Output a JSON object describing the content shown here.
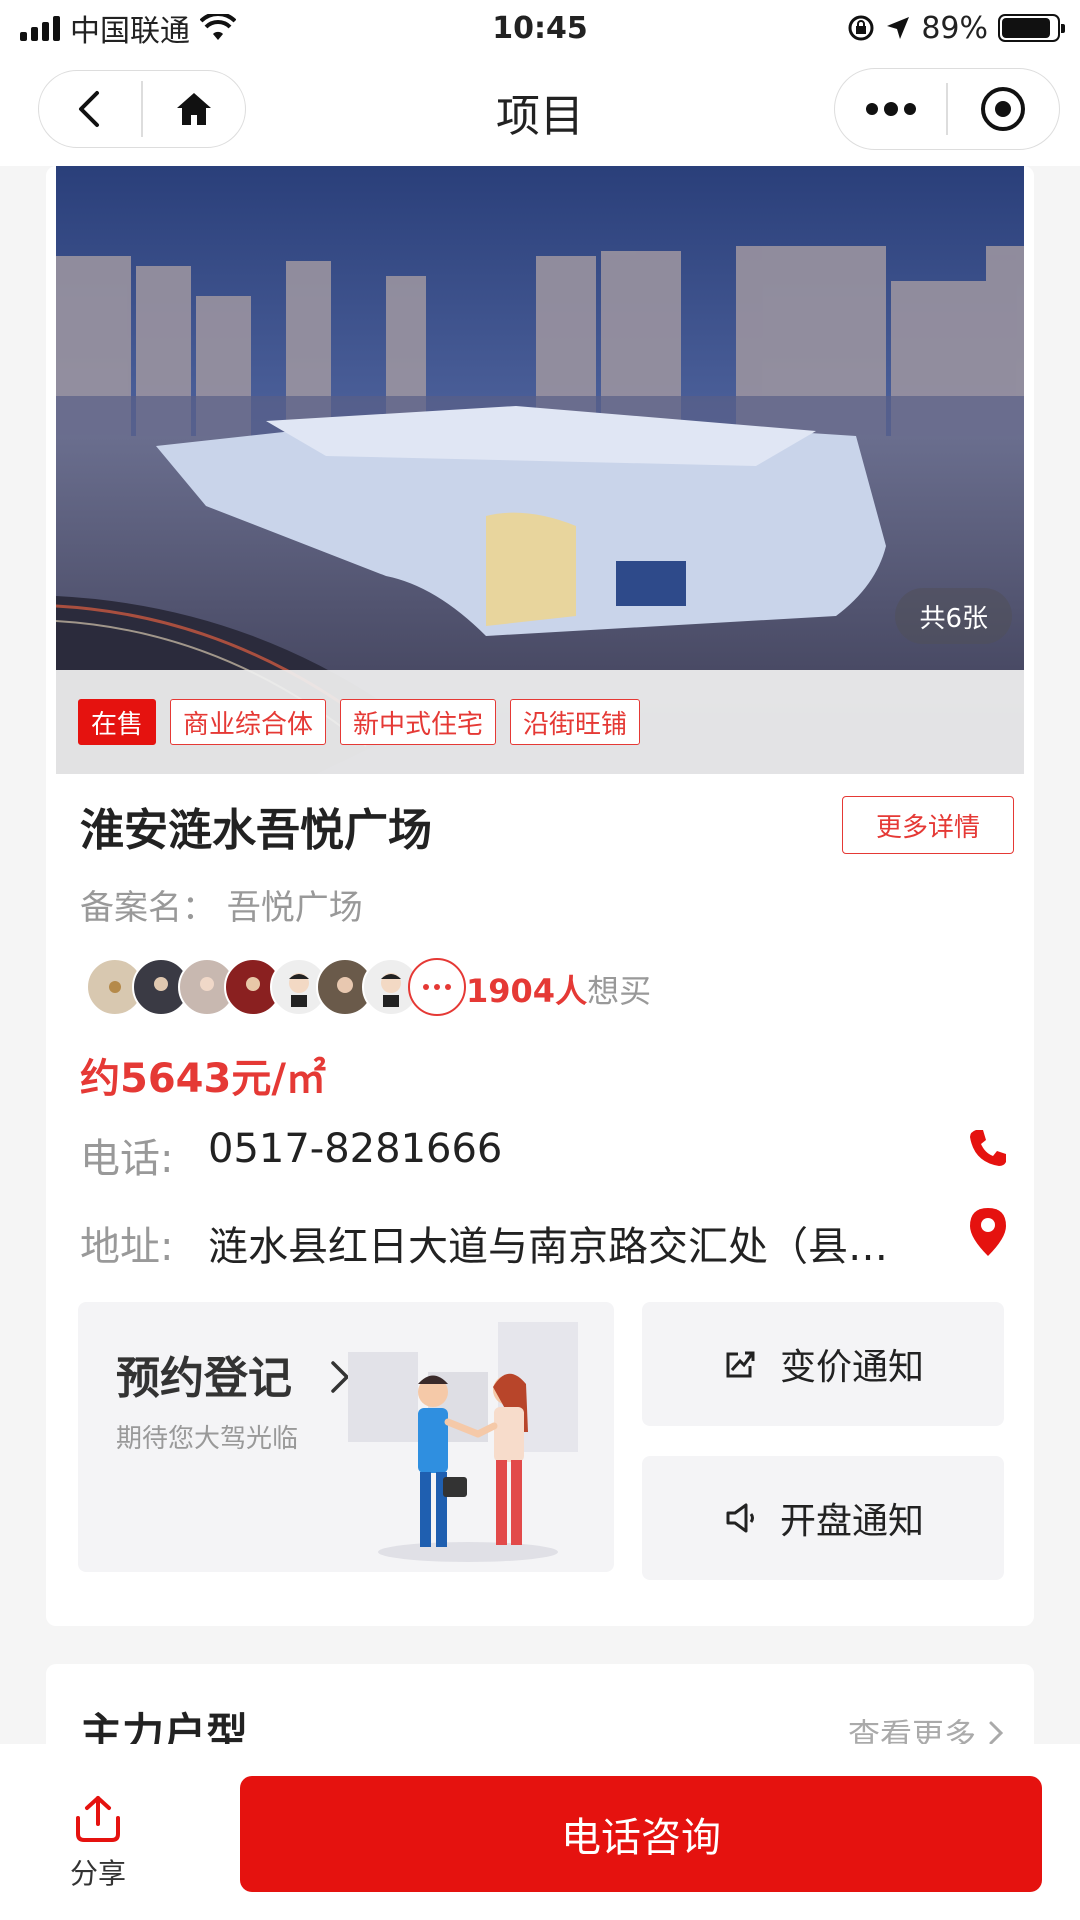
{
  "status_bar": {
    "carrier": "中国联通",
    "time": "10:45",
    "battery": "89%",
    "battery_level": 0.89
  },
  "nav": {
    "title": "项目"
  },
  "project": {
    "photo_count": "共6张",
    "tags": [
      "在售",
      "商业综合体",
      "新中式住宅",
      "沿街旺铺"
    ],
    "name": "淮安涟水吾悦广场",
    "more_details": "更多详情",
    "record_name": "备案名：  吾悦广场",
    "want_count": "1904人",
    "want_label": "想买",
    "price": "约5643元/㎡",
    "phone_label": "电话:",
    "phone": "0517-8281666",
    "address_label": "地址:",
    "address": "涟水县红日大道与南京路交汇处（县…",
    "booking_title": "预约登记",
    "booking_subtitle": "期待您大驾光临",
    "price_notice": "变价通知",
    "opening_notice": "开盘通知"
  },
  "floor_plans": {
    "title": "主力户型",
    "more": "查看更多"
  },
  "bottom": {
    "share": "分享",
    "call": "电话咨询"
  },
  "colors": {
    "brand_red": "#e5120f"
  }
}
